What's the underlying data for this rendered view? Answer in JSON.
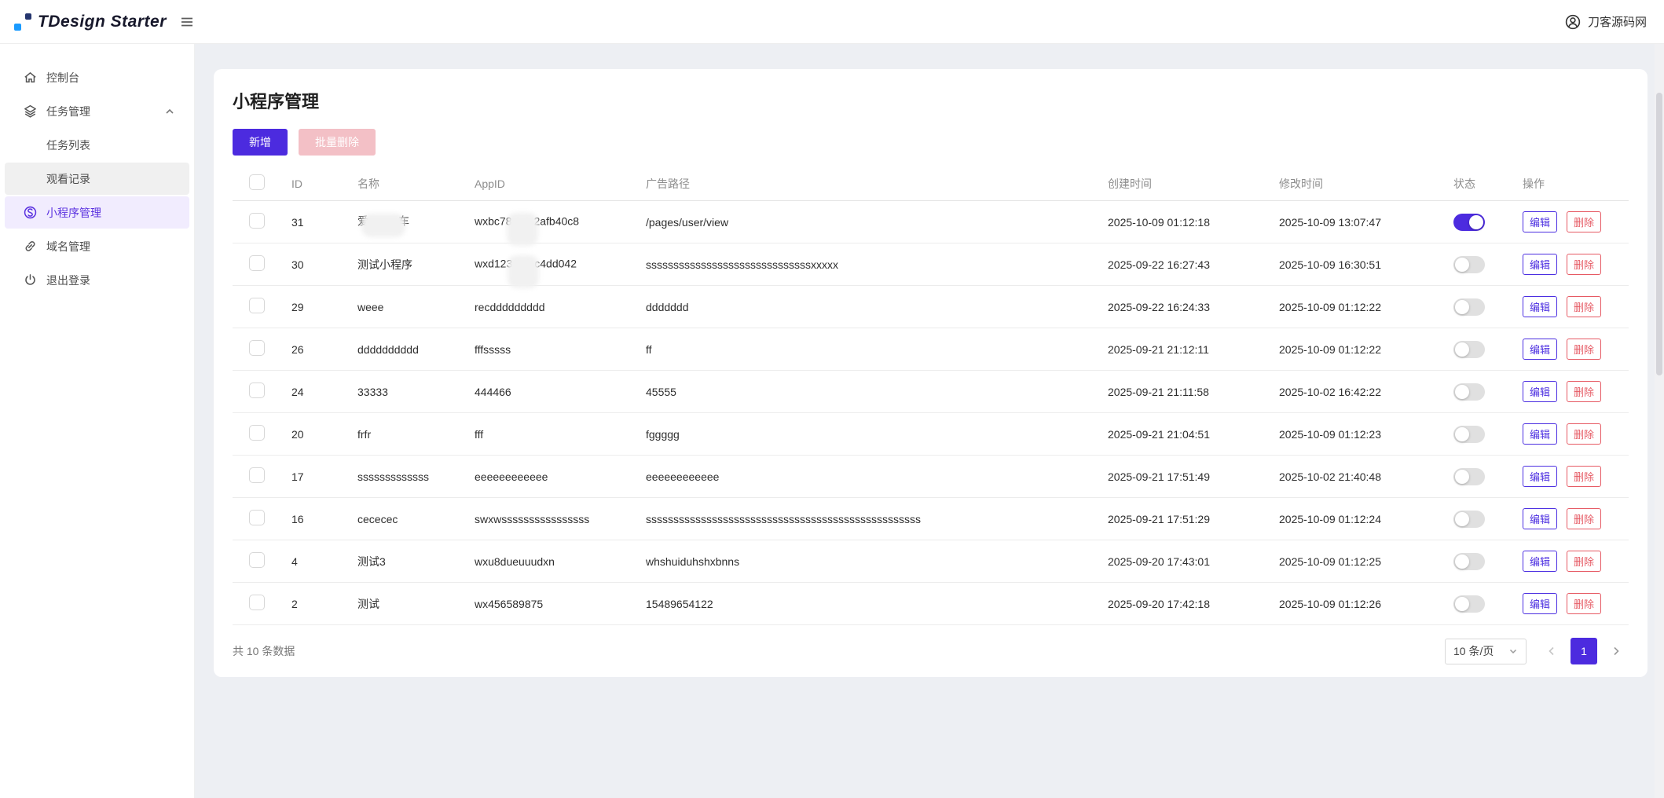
{
  "topbar": {
    "logo_text": "TDesign Starter",
    "user_name": "刀客源码网"
  },
  "sidebar": {
    "items": [
      {
        "label": "控制台",
        "icon": "home"
      },
      {
        "label": "任务管理",
        "icon": "layers",
        "expanded": true
      },
      {
        "label": "任务列表",
        "submenu": true
      },
      {
        "label": "观看记录",
        "submenu": true
      },
      {
        "label": "小程序管理",
        "icon": "miniprogram",
        "active": true
      },
      {
        "label": "域名管理",
        "icon": "link"
      },
      {
        "label": "退出登录",
        "icon": "power"
      }
    ]
  },
  "page": {
    "title": "小程序管理",
    "buttons": {
      "add": "新增",
      "batch_delete": "批量删除"
    }
  },
  "table": {
    "headers": {
      "id": "ID",
      "name": "名称",
      "appid": "AppID",
      "path": "广告路径",
      "created": "创建时间",
      "modified": "修改时间",
      "status": "状态",
      "actions": "操作"
    },
    "actions": {
      "edit": "编辑",
      "delete": "删除"
    },
    "rows": [
      {
        "id": "31",
        "name_prefix": "爱",
        "name_suffix": "车",
        "name_censored": true,
        "appid_prefix": "wxbc78",
        "appid_suffix": "2afb40c8",
        "appid_censored": true,
        "path": "/pages/user/view",
        "created": "2025-10-09 01:12:18",
        "modified": "2025-10-09 13:07:47",
        "status": true
      },
      {
        "id": "30",
        "name": "测试小程序",
        "appid_prefix": "wxd123",
        "appid_suffix": "c4dd042",
        "appid_censored": true,
        "path": "ssssssssssssssssssssssssssssssxxxxx",
        "created": "2025-09-22 16:27:43",
        "modified": "2025-10-09 16:30:51",
        "status": false
      },
      {
        "id": "29",
        "name": "weee",
        "appid": "recddddddddd",
        "path": "ddddddd",
        "created": "2025-09-22 16:24:33",
        "modified": "2025-10-09 01:12:22",
        "status": false
      },
      {
        "id": "26",
        "name": "dddddddddd",
        "appid": "fffsssss",
        "path": "ff",
        "created": "2025-09-21 21:12:11",
        "modified": "2025-10-09 01:12:22",
        "status": false
      },
      {
        "id": "24",
        "name": "33333",
        "appid": "444466",
        "path": "45555",
        "created": "2025-09-21 21:11:58",
        "modified": "2025-10-02 16:42:22",
        "status": false
      },
      {
        "id": "20",
        "name": "frfr",
        "appid": "fff",
        "path": "fggggg",
        "created": "2025-09-21 21:04:51",
        "modified": "2025-10-09 01:12:23",
        "status": false
      },
      {
        "id": "17",
        "name": "sssssssssssss",
        "appid": "eeeeeeeeeeee",
        "path": "eeeeeeeeeeee",
        "created": "2025-09-21 17:51:49",
        "modified": "2025-10-02 21:40:48",
        "status": false
      },
      {
        "id": "16",
        "name": "cececec",
        "appid": "swxwssssssssssssssss",
        "path": "ssssssssssssssssssssssssssssssssssssssssssssssssss",
        "created": "2025-09-21 17:51:29",
        "modified": "2025-10-09 01:12:24",
        "status": false
      },
      {
        "id": "4",
        "name": "测试3",
        "appid": "wxu8dueuuudxn",
        "path": "whshuiduhshxbnns",
        "created": "2025-09-20 17:43:01",
        "modified": "2025-10-09 01:12:25",
        "status": false
      },
      {
        "id": "2",
        "name": "测试",
        "appid": "wx456589875",
        "path": "15489654122",
        "created": "2025-09-20 17:42:18",
        "modified": "2025-10-09 01:12:26",
        "status": false
      }
    ]
  },
  "pagination": {
    "total": "共 10 条数据",
    "page_size": "10 条/页",
    "page": "1"
  },
  "colors": {
    "primary": "#4c2bdf",
    "primary_light_bg": "#f1ecfe",
    "danger": "#e65a64",
    "danger_disabled_bg": "#f3c0c6"
  }
}
